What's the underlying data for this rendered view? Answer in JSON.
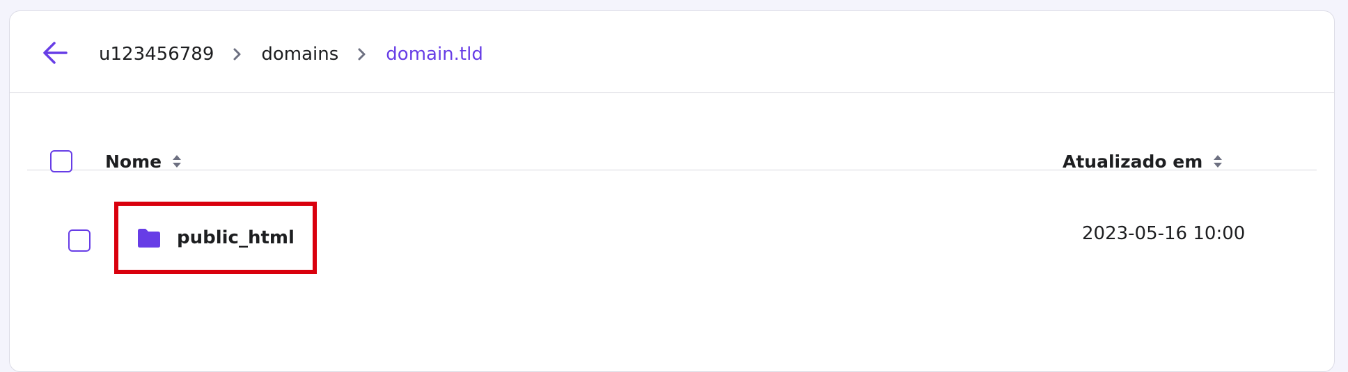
{
  "breadcrumb": {
    "items": [
      "u123456789",
      "domains",
      "domain.tld"
    ]
  },
  "table": {
    "columns": {
      "name": "Nome",
      "updated": "Atualizado em"
    },
    "rows": [
      {
        "name": "public_html",
        "updated": "2023-05-16 10:00",
        "type": "folder"
      }
    ]
  },
  "icons": {
    "back": "arrow-left-icon",
    "separator": "chevron-right-icon",
    "sort": "sort-icon",
    "folder": "folder-icon"
  },
  "colors": {
    "accent": "#673de6",
    "highlight": "#d9000d",
    "text": "#1d1e20"
  }
}
